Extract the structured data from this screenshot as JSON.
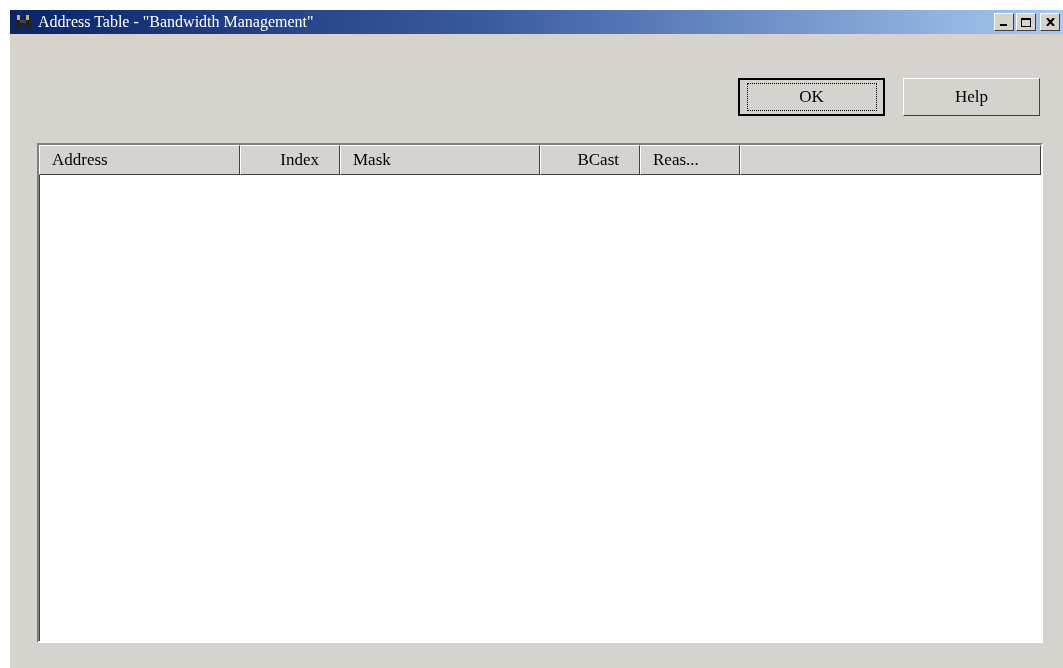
{
  "window": {
    "title": "Address Table - \"Bandwidth Management\""
  },
  "buttons": [
    {
      "label": "OK",
      "default": true
    },
    {
      "label": "Help",
      "default": false
    }
  ],
  "table": {
    "columns": [
      {
        "label": "Address",
        "right_aligned": false
      },
      {
        "label": "Index",
        "right_aligned": true
      },
      {
        "label": "Mask",
        "right_aligned": false
      },
      {
        "label": "BCast",
        "right_aligned": true
      },
      {
        "label": "Reas...",
        "right_aligned": false
      }
    ]
  }
}
